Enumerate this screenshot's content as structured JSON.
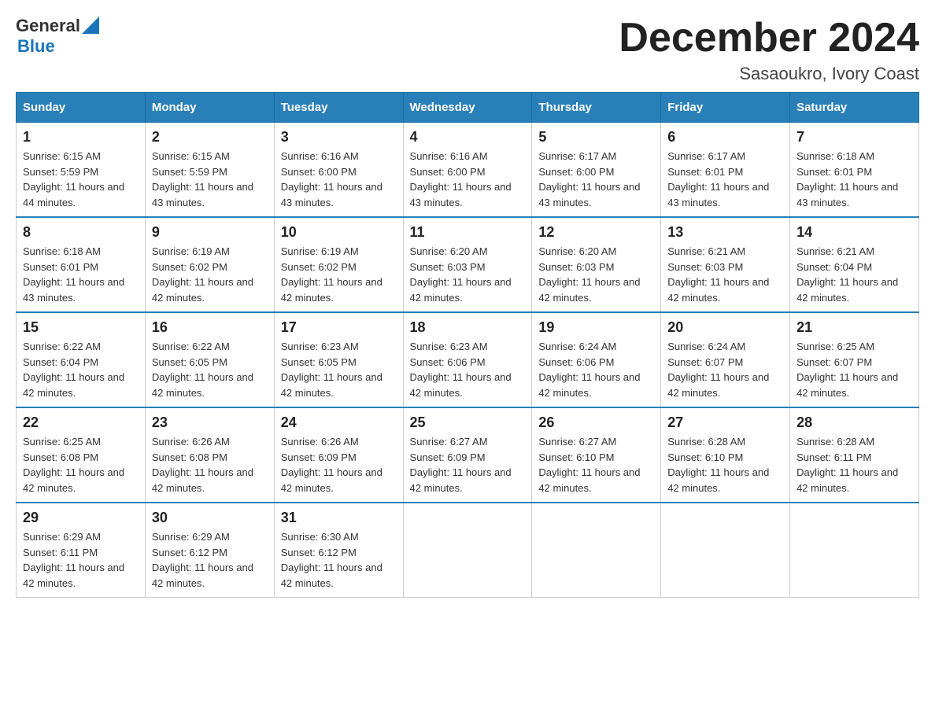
{
  "header": {
    "logo": {
      "general": "General",
      "blue": "Blue"
    },
    "title": "December 2024",
    "location": "Sasaoukro, Ivory Coast"
  },
  "columns": [
    "Sunday",
    "Monday",
    "Tuesday",
    "Wednesday",
    "Thursday",
    "Friday",
    "Saturday"
  ],
  "weeks": [
    [
      {
        "day": "1",
        "sunrise": "Sunrise: 6:15 AM",
        "sunset": "Sunset: 5:59 PM",
        "daylight": "Daylight: 11 hours and 44 minutes."
      },
      {
        "day": "2",
        "sunrise": "Sunrise: 6:15 AM",
        "sunset": "Sunset: 5:59 PM",
        "daylight": "Daylight: 11 hours and 43 minutes."
      },
      {
        "day": "3",
        "sunrise": "Sunrise: 6:16 AM",
        "sunset": "Sunset: 6:00 PM",
        "daylight": "Daylight: 11 hours and 43 minutes."
      },
      {
        "day": "4",
        "sunrise": "Sunrise: 6:16 AM",
        "sunset": "Sunset: 6:00 PM",
        "daylight": "Daylight: 11 hours and 43 minutes."
      },
      {
        "day": "5",
        "sunrise": "Sunrise: 6:17 AM",
        "sunset": "Sunset: 6:00 PM",
        "daylight": "Daylight: 11 hours and 43 minutes."
      },
      {
        "day": "6",
        "sunrise": "Sunrise: 6:17 AM",
        "sunset": "Sunset: 6:01 PM",
        "daylight": "Daylight: 11 hours and 43 minutes."
      },
      {
        "day": "7",
        "sunrise": "Sunrise: 6:18 AM",
        "sunset": "Sunset: 6:01 PM",
        "daylight": "Daylight: 11 hours and 43 minutes."
      }
    ],
    [
      {
        "day": "8",
        "sunrise": "Sunrise: 6:18 AM",
        "sunset": "Sunset: 6:01 PM",
        "daylight": "Daylight: 11 hours and 43 minutes."
      },
      {
        "day": "9",
        "sunrise": "Sunrise: 6:19 AM",
        "sunset": "Sunset: 6:02 PM",
        "daylight": "Daylight: 11 hours and 42 minutes."
      },
      {
        "day": "10",
        "sunrise": "Sunrise: 6:19 AM",
        "sunset": "Sunset: 6:02 PM",
        "daylight": "Daylight: 11 hours and 42 minutes."
      },
      {
        "day": "11",
        "sunrise": "Sunrise: 6:20 AM",
        "sunset": "Sunset: 6:03 PM",
        "daylight": "Daylight: 11 hours and 42 minutes."
      },
      {
        "day": "12",
        "sunrise": "Sunrise: 6:20 AM",
        "sunset": "Sunset: 6:03 PM",
        "daylight": "Daylight: 11 hours and 42 minutes."
      },
      {
        "day": "13",
        "sunrise": "Sunrise: 6:21 AM",
        "sunset": "Sunset: 6:03 PM",
        "daylight": "Daylight: 11 hours and 42 minutes."
      },
      {
        "day": "14",
        "sunrise": "Sunrise: 6:21 AM",
        "sunset": "Sunset: 6:04 PM",
        "daylight": "Daylight: 11 hours and 42 minutes."
      }
    ],
    [
      {
        "day": "15",
        "sunrise": "Sunrise: 6:22 AM",
        "sunset": "Sunset: 6:04 PM",
        "daylight": "Daylight: 11 hours and 42 minutes."
      },
      {
        "day": "16",
        "sunrise": "Sunrise: 6:22 AM",
        "sunset": "Sunset: 6:05 PM",
        "daylight": "Daylight: 11 hours and 42 minutes."
      },
      {
        "day": "17",
        "sunrise": "Sunrise: 6:23 AM",
        "sunset": "Sunset: 6:05 PM",
        "daylight": "Daylight: 11 hours and 42 minutes."
      },
      {
        "day": "18",
        "sunrise": "Sunrise: 6:23 AM",
        "sunset": "Sunset: 6:06 PM",
        "daylight": "Daylight: 11 hours and 42 minutes."
      },
      {
        "day": "19",
        "sunrise": "Sunrise: 6:24 AM",
        "sunset": "Sunset: 6:06 PM",
        "daylight": "Daylight: 11 hours and 42 minutes."
      },
      {
        "day": "20",
        "sunrise": "Sunrise: 6:24 AM",
        "sunset": "Sunset: 6:07 PM",
        "daylight": "Daylight: 11 hours and 42 minutes."
      },
      {
        "day": "21",
        "sunrise": "Sunrise: 6:25 AM",
        "sunset": "Sunset: 6:07 PM",
        "daylight": "Daylight: 11 hours and 42 minutes."
      }
    ],
    [
      {
        "day": "22",
        "sunrise": "Sunrise: 6:25 AM",
        "sunset": "Sunset: 6:08 PM",
        "daylight": "Daylight: 11 hours and 42 minutes."
      },
      {
        "day": "23",
        "sunrise": "Sunrise: 6:26 AM",
        "sunset": "Sunset: 6:08 PM",
        "daylight": "Daylight: 11 hours and 42 minutes."
      },
      {
        "day": "24",
        "sunrise": "Sunrise: 6:26 AM",
        "sunset": "Sunset: 6:09 PM",
        "daylight": "Daylight: 11 hours and 42 minutes."
      },
      {
        "day": "25",
        "sunrise": "Sunrise: 6:27 AM",
        "sunset": "Sunset: 6:09 PM",
        "daylight": "Daylight: 11 hours and 42 minutes."
      },
      {
        "day": "26",
        "sunrise": "Sunrise: 6:27 AM",
        "sunset": "Sunset: 6:10 PM",
        "daylight": "Daylight: 11 hours and 42 minutes."
      },
      {
        "day": "27",
        "sunrise": "Sunrise: 6:28 AM",
        "sunset": "Sunset: 6:10 PM",
        "daylight": "Daylight: 11 hours and 42 minutes."
      },
      {
        "day": "28",
        "sunrise": "Sunrise: 6:28 AM",
        "sunset": "Sunset: 6:11 PM",
        "daylight": "Daylight: 11 hours and 42 minutes."
      }
    ],
    [
      {
        "day": "29",
        "sunrise": "Sunrise: 6:29 AM",
        "sunset": "Sunset: 6:11 PM",
        "daylight": "Daylight: 11 hours and 42 minutes."
      },
      {
        "day": "30",
        "sunrise": "Sunrise: 6:29 AM",
        "sunset": "Sunset: 6:12 PM",
        "daylight": "Daylight: 11 hours and 42 minutes."
      },
      {
        "day": "31",
        "sunrise": "Sunrise: 6:30 AM",
        "sunset": "Sunset: 6:12 PM",
        "daylight": "Daylight: 11 hours and 42 minutes."
      },
      null,
      null,
      null,
      null
    ]
  ]
}
